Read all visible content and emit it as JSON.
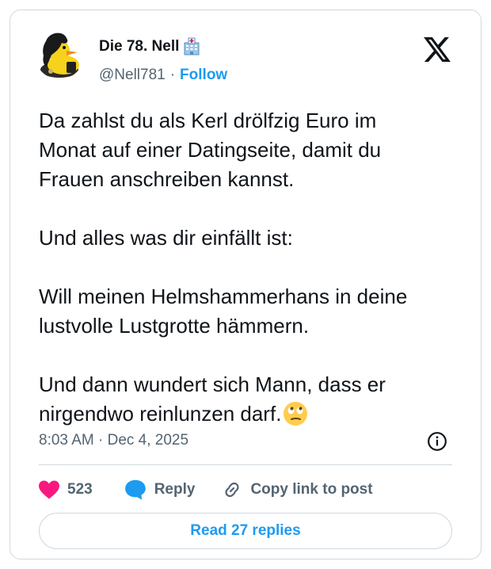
{
  "author": {
    "display_name": "Die 78. Nell",
    "name_icon": "hospital-emoji",
    "handle": "@Nell781",
    "separator": "·",
    "follow_label": "Follow",
    "avatar": "rubber-duck-avatar"
  },
  "platform_icon": "x-logo-icon",
  "tweet": {
    "text": "Da zahlst du als Kerl drölfzig Euro im\nMonat auf einer Datingseite, damit du\nFrauen anschreiben kannst.\n\nUnd alles was dir einfällt ist:\n\nWill meinen Helmshammerhans in deine\nlustvolle Lustgrotte hämmern.\n\nUnd dann wundert sich Mann, dass er\nnirgendwo reinlunzen darf.",
    "trailing_emoji": "eye-roll-emoji"
  },
  "timestamp": "8:03 AM · Dec 4, 2025",
  "actions": {
    "like_count": "523",
    "reply_label": "Reply",
    "copy_label": "Copy link to post"
  },
  "read_replies_label": "Read 27 replies",
  "colors": {
    "accent": "#1d9bf0",
    "like": "#f91880",
    "text": "#0f1419",
    "muted": "#536471",
    "border": "#cfd9de"
  }
}
